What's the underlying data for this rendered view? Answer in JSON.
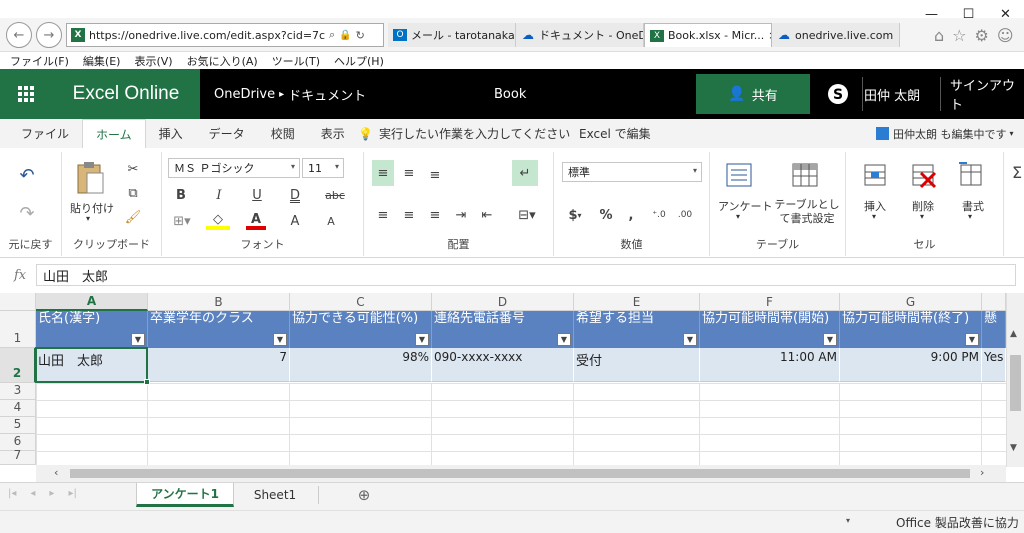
{
  "browser": {
    "url": "https://onedrive.live.com/edit.aspx?cid=7c4d17!",
    "tabs": [
      {
        "label": "メール - tarotanaka19...",
        "icon": "outlook-icon"
      },
      {
        "label": "ドキュメント - OneDrive",
        "icon": "onedrive-icon"
      },
      {
        "label": "Book.xlsx - Micr...",
        "icon": "excel-icon"
      },
      {
        "label": "onedrive.live.com",
        "icon": "onedrive-icon"
      }
    ],
    "active_tab": 2,
    "tab_close": "×",
    "menu": [
      "ファイル(F)",
      "編集(E)",
      "表示(V)",
      "お気に入り(A)",
      "ツール(T)",
      "ヘルプ(H)"
    ]
  },
  "app": {
    "name": "Excel Online",
    "breadcrumb_root": "OneDrive",
    "breadcrumb_sep": "▸",
    "breadcrumb_folder": "ドキュメント",
    "doc_title": "Book",
    "share_label": "共有",
    "user_name": "田仲 太朗",
    "sign_out": "サインアウト"
  },
  "ribbon_tabs": [
    "ファイル",
    "ホーム",
    "挿入",
    "データ",
    "校閲",
    "表示"
  ],
  "active_ribbon_tab": 1,
  "tell_me": "実行したい作業を入力してください",
  "edit_in_excel": "Excel で編集",
  "also_editing": "田仲太朗 も編集中です",
  "ribbon": {
    "undo_group": "元に戻す",
    "clipboard_group": "クリップボード",
    "paste_label": "貼り付け",
    "font_group": "フォント",
    "font_name": "ＭＳ Ｐゴシック",
    "font_size": "11",
    "bold": "B",
    "italic": "I",
    "underline": "U",
    "double_underline": "D",
    "strike": "abc",
    "grow_font": "A",
    "shrink_font": "A",
    "font_color": "A",
    "alignment_group": "配置",
    "number_group": "数値",
    "number_format": "標準",
    "currency": "$",
    "percent": "%",
    "comma": ",",
    "table_group": "テーブル",
    "survey_label": "アンケート",
    "format_as_table_label": "テーブルとして書式設定",
    "cells_group": "セル",
    "insert_label": "挿入",
    "delete_label": "削除",
    "format_label": "書式"
  },
  "formula_bar": {
    "fx": "fx",
    "value": "山田　太郎"
  },
  "grid": {
    "columns": [
      "A",
      "B",
      "C",
      "D",
      "E",
      "F",
      "G"
    ],
    "selected_column": "A",
    "rows": [
      "1",
      "2",
      "3",
      "4",
      "5",
      "6",
      "7"
    ],
    "selected_row": "2",
    "headers": [
      "氏名(漢字)",
      "卒業学年のクラス",
      "協力できる可能性(%)",
      "連絡先電話番号",
      "希望する担当",
      "協力可能時間帯(開始)",
      "協力可能時間帯(終了)",
      "懸"
    ],
    "row2": [
      "山田　太郎",
      "7",
      "98%",
      "090-xxxx-xxxx",
      "受付",
      "11:00 AM",
      "9:00 PM",
      "Yes"
    ]
  },
  "sheets": {
    "tabs": [
      "アンケート1",
      "Sheet1"
    ],
    "active": 0,
    "add": "⊕"
  },
  "status": {
    "text": "Office 製品改善に協力"
  },
  "colors": {
    "excel_green": "#217346",
    "table_header": "#5b82c0",
    "table_row": "#dce6f1"
  }
}
